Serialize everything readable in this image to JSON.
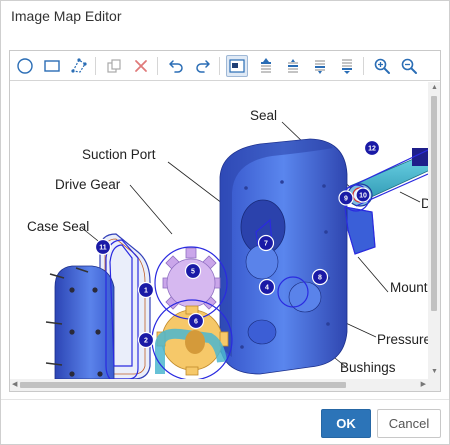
{
  "dialog": {
    "title": "Image Map Editor"
  },
  "toolbar": {
    "tools": [
      {
        "name": "circle-tool-icon"
      },
      {
        "name": "rectangle-tool-icon"
      },
      {
        "name": "polygon-tool-icon"
      },
      {
        "name": "duplicate-icon"
      },
      {
        "name": "delete-icon"
      },
      {
        "name": "undo-icon"
      },
      {
        "name": "redo-icon"
      },
      {
        "name": "select-tool-icon",
        "active": true
      },
      {
        "name": "bring-to-front-icon"
      },
      {
        "name": "bring-forward-icon"
      },
      {
        "name": "send-backward-icon"
      },
      {
        "name": "send-to-back-icon"
      },
      {
        "name": "zoom-in-icon"
      },
      {
        "name": "zoom-out-icon"
      }
    ]
  },
  "image": {
    "labels": {
      "seal": "Seal",
      "suction_port": "Suction Port",
      "drive_gear": "Drive Gear",
      "case_seal": "Case Seal",
      "mount": "Mount",
      "pressure": "Pressure",
      "bushings": "Bushings",
      "d_cut": "D"
    },
    "hotspots": [
      "1",
      "2",
      "4",
      "5",
      "6",
      "7",
      "8",
      "9",
      "10",
      "11",
      "12"
    ]
  },
  "footer": {
    "ok_label": "OK",
    "cancel_label": "Cancel"
  },
  "colors": {
    "accent": "#2c74b8",
    "hotspot": "#1a1aa6",
    "hotspot_outline": "#2a2ae0",
    "pump_body": "#4a6fe0",
    "gear": "#c9a8e8",
    "idler": "#f5c56a"
  }
}
